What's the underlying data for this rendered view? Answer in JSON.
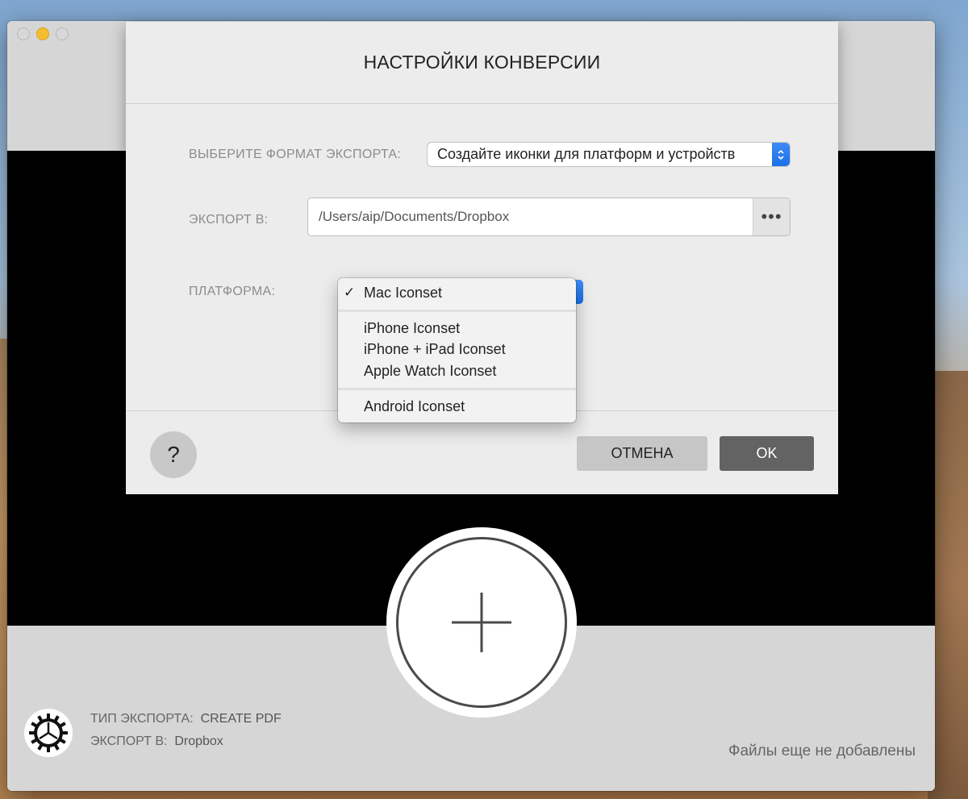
{
  "sheet": {
    "title": "НАСТРОЙКИ КОНВЕРСИИ",
    "format_label": "ВЫБЕРИТЕ ФОРМАТ ЭКСПОРТА:",
    "format_value": "Создайте иконки для платформ и устройств",
    "export_label": "ЭКСПОРТ В:",
    "export_path": "/Users/aip/Documents/Dropbox",
    "browse_label": "•••",
    "platform_label": "ПЛАТФОРМА:",
    "help_label": "?",
    "cancel_label": "ОТМЕНА",
    "ok_label": "OK"
  },
  "platform_menu": {
    "check_mark": "✓",
    "items": [
      {
        "label": "Mac Iconset",
        "selected": true
      },
      {
        "label": "iPhone Iconset",
        "selected": false
      },
      {
        "label": "iPhone + iPad Iconset",
        "selected": false
      },
      {
        "label": "Apple Watch Iconset",
        "selected": false
      },
      {
        "label": "Android Iconset",
        "selected": false
      }
    ]
  },
  "status": {
    "export_type_key": "ТИП ЭКСПОРТА:",
    "export_type_value": "CREATE PDF",
    "export_to_key": "ЭКСПОРТ В:",
    "export_to_value": "Dropbox",
    "no_files": "Файлы еще не добавлены"
  },
  "icons": {
    "add": "plus-icon",
    "settings": "gear-icon",
    "stepper": "chevron-updown-icon"
  },
  "colors": {
    "accent": "#1a6fe8",
    "ok_button": "#636363",
    "cancel_button": "#c6c6c6",
    "minimize": "#f5bd2f"
  }
}
